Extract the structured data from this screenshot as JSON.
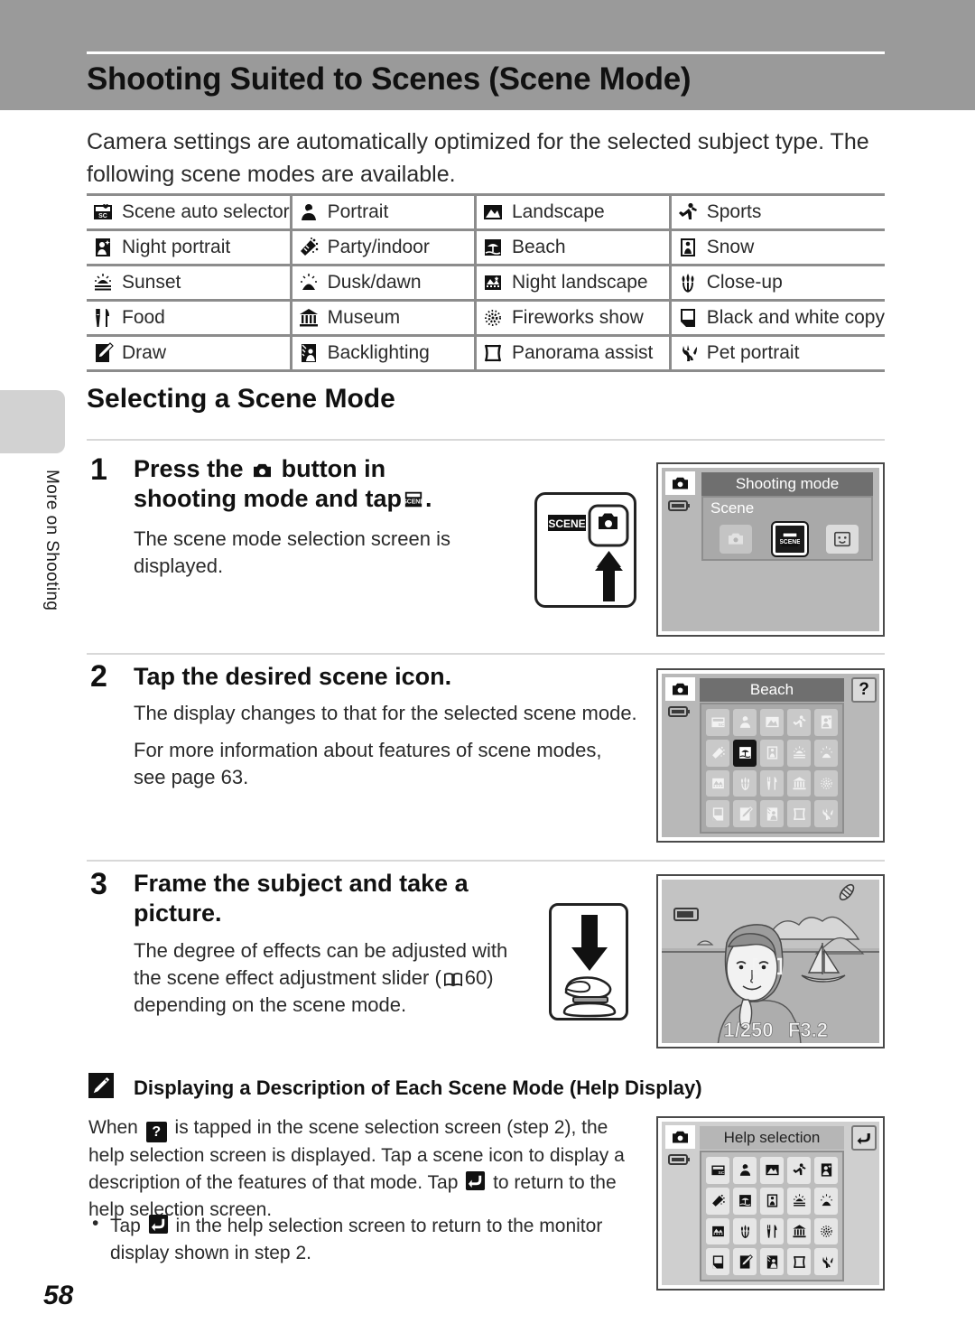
{
  "header": {
    "title": "Shooting Suited to Scenes (Scene Mode)"
  },
  "sidebar": {
    "chapter_label": "More on Shooting"
  },
  "page": {
    "number": "58"
  },
  "intro": {
    "text": "Camera settings are automatically optimized for the selected subject type. The following scene modes are available."
  },
  "scene_table": {
    "rows": [
      [
        {
          "icon": "scene-auto-selector-icon",
          "label": "Scene auto selector"
        },
        {
          "icon": "portrait-icon",
          "label": "Portrait"
        },
        {
          "icon": "landscape-icon",
          "label": "Landscape"
        },
        {
          "icon": "sports-icon",
          "label": "Sports"
        }
      ],
      [
        {
          "icon": "night-portrait-icon",
          "label": "Night portrait"
        },
        {
          "icon": "party-indoor-icon",
          "label": "Party/indoor"
        },
        {
          "icon": "beach-icon",
          "label": "Beach"
        },
        {
          "icon": "snow-icon",
          "label": "Snow"
        }
      ],
      [
        {
          "icon": "sunset-icon",
          "label": "Sunset"
        },
        {
          "icon": "dusk-dawn-icon",
          "label": "Dusk/dawn"
        },
        {
          "icon": "night-landscape-icon",
          "label": "Night landscape"
        },
        {
          "icon": "close-up-icon",
          "label": "Close-up"
        }
      ],
      [
        {
          "icon": "food-icon",
          "label": "Food"
        },
        {
          "icon": "museum-icon",
          "label": "Museum"
        },
        {
          "icon": "fireworks-show-icon",
          "label": "Fireworks show"
        },
        {
          "icon": "black-and-white-copy-icon",
          "label": "Black and white copy"
        }
      ],
      [
        {
          "icon": "draw-icon",
          "label": "Draw"
        },
        {
          "icon": "backlighting-icon",
          "label": "Backlighting"
        },
        {
          "icon": "panorama-assist-icon",
          "label": "Panorama assist"
        },
        {
          "icon": "pet-portrait-icon",
          "label": "Pet portrait"
        }
      ]
    ]
  },
  "section": {
    "heading": "Selecting a Scene Mode"
  },
  "steps": [
    {
      "number": "1",
      "title_part1": "Press the",
      "title_part2": "button in shooting mode and tap",
      "title_part3": ".",
      "body": "The scene mode selection screen is displayed."
    },
    {
      "number": "2",
      "title": "Tap the desired scene icon.",
      "body1": "The display changes to that for the selected scene mode.",
      "body2": "For more information about features of scene modes, see page 63."
    },
    {
      "number": "3",
      "title": "Frame the subject and take a picture.",
      "body_part1": "The degree of effects can be adjusted with the scene effect adjustment slider (",
      "body_page_ref": "60",
      "body_part2": ") depending on the scene mode."
    }
  ],
  "monitors": {
    "shooting_mode": {
      "title": "Shooting mode",
      "label": "Scene",
      "options": [
        "auto-mode-icon",
        "scene-mode-icon",
        "smart-portrait-icon"
      ],
      "selected_index": 1
    },
    "scene_selection": {
      "title": "Beach",
      "help_button": "?",
      "selected_index": 6,
      "icons": [
        "scene-auto-selector-icon",
        "portrait-icon",
        "landscape-icon",
        "sports-icon",
        "night-portrait-icon",
        "party-indoor-icon",
        "beach-icon",
        "snow-icon",
        "sunset-icon",
        "dusk-dawn-icon",
        "night-landscape-icon",
        "close-up-icon",
        "food-icon",
        "museum-icon",
        "fireworks-show-icon",
        "black-and-white-copy-icon",
        "draw-icon",
        "backlighting-icon",
        "panorama-assist-icon",
        "pet-portrait-icon"
      ]
    },
    "live_view": {
      "shutter_speed": "1/250",
      "aperture": "F3.2"
    },
    "help_selection": {
      "title": "Help selection",
      "back_button": "back-arrow-icon",
      "icons": [
        "scene-auto-selector-icon",
        "portrait-icon",
        "landscape-icon",
        "sports-icon",
        "night-portrait-icon",
        "party-indoor-icon",
        "beach-icon",
        "snow-icon",
        "sunset-icon",
        "dusk-dawn-icon",
        "night-landscape-icon",
        "close-up-icon",
        "food-icon",
        "museum-icon",
        "fireworks-show-icon",
        "black-and-white-copy-icon",
        "draw-icon",
        "backlighting-icon",
        "panorama-assist-icon",
        "pet-portrait-icon"
      ]
    }
  },
  "note": {
    "heading": "Displaying a Description of Each Scene Mode (Help Display)",
    "para_a": "When",
    "para_b": "is tapped in the scene selection screen (step 2), the help selection screen is displayed. Tap a scene icon to display a description of the features of that mode. Tap",
    "para_c": "to return to the help selection screen.",
    "bullet_a": "Tap",
    "bullet_b": "in the help selection screen to return to the monitor display shown in step 2."
  },
  "colors": {
    "header_band": "#9a9a9a",
    "side_tab": "#d2d2d2",
    "table_rule": "#8c8c8c",
    "monitor_bg": "#b8b8b8",
    "monitor_titlebar": "#6f6f6f"
  }
}
